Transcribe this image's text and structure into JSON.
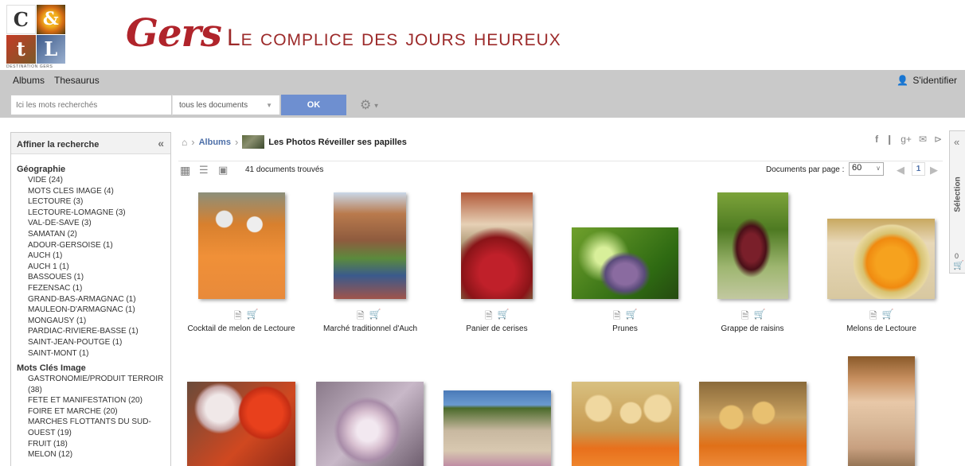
{
  "header": {
    "logo_letters": [
      "C",
      "&",
      "t",
      "L"
    ],
    "logo_sub": "DESTINATION GERS",
    "brand": "Gers",
    "tagline": "Le complice des jours heureux"
  },
  "nav": {
    "albums": "Albums",
    "thesaurus": "Thesaurus",
    "login": "S'identifier"
  },
  "search": {
    "placeholder": "Ici les mots recherchés",
    "scope": "tous les documents",
    "ok": "OK"
  },
  "sidebar": {
    "title": "Affiner la recherche",
    "collapse": "«",
    "facets": [
      {
        "title": "Géographie",
        "items": [
          "VIDE (24)",
          "MOTS CLES IMAGE (4)",
          "LECTOURE (3)",
          "LECTOURE-LOMAGNE (3)",
          "VAL-DE-SAVE (3)",
          "SAMATAN (2)",
          "ADOUR-GERSOISE (1)",
          "AUCH (1)",
          "AUCH 1 (1)",
          "BASSOUES (1)",
          "FEZENSAC (1)",
          "GRAND-BAS-ARMAGNAC (1)",
          "MAULEON-D'ARMAGNAC (1)",
          "MONGAUSY (1)",
          "PARDIAC-RIVIERE-BASSE (1)",
          "SAINT-JEAN-POUTGE (1)",
          "SAINT-MONT (1)"
        ]
      },
      {
        "title": "Mots Clés Image",
        "items": [
          "GASTRONOMIE/PRODUIT TERROIR (38)",
          "FETE ET MANIFESTATION (20)",
          "FOIRE ET MARCHE (20)",
          "MARCHES FLOTTANTS DU SUD-OUEST (19)",
          "FRUIT (18)",
          "MELON (12)"
        ]
      }
    ]
  },
  "breadcrumb": {
    "albums": "Albums",
    "current": "Les Photos Réveiller ses papilles"
  },
  "toolbar": {
    "doc_count": "41 documents trouvés",
    "per_page_label": "Documents par page :",
    "per_page_value": "60",
    "page": "1"
  },
  "share_icons": [
    "facebook-icon",
    "twitter-icon",
    "google-plus-icon",
    "mail-icon",
    "share-icon"
  ],
  "grid": {
    "row1": [
      {
        "title": "Cocktail de melon de Lectoure"
      },
      {
        "title": "Marché traditionnel d'Auch"
      },
      {
        "title": "Panier de cerises"
      },
      {
        "title": "Prunes"
      },
      {
        "title": "Grappe de raisins"
      },
      {
        "title": "Melons de Lectoure"
      }
    ],
    "row2_count": 6
  },
  "selection": {
    "label": "Sélection",
    "count": "0",
    "collapse": "«"
  }
}
